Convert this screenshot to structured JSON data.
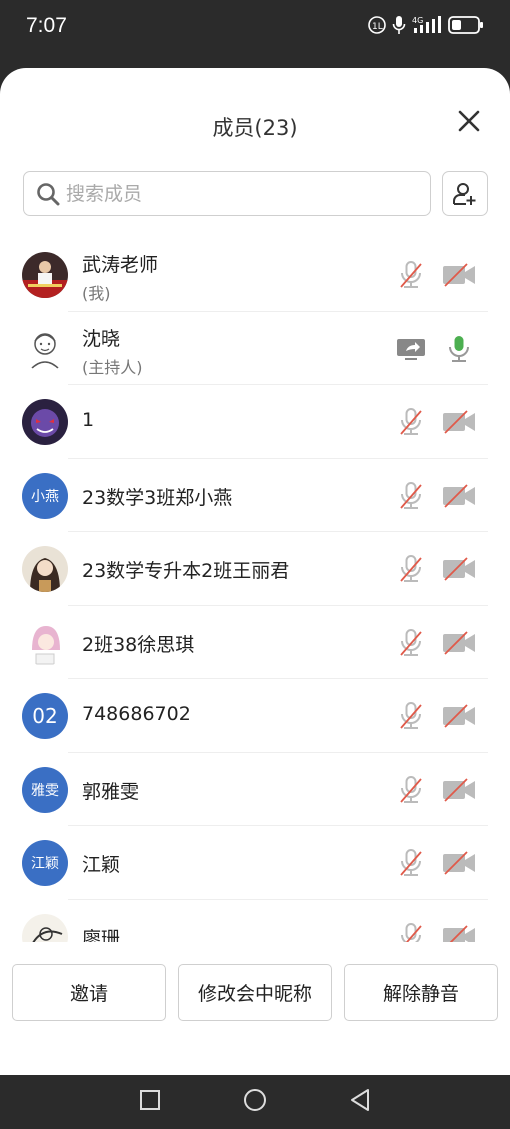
{
  "status": {
    "time": "7:07",
    "network": "4G"
  },
  "header": {
    "title": "成员(23)"
  },
  "search": {
    "placeholder": "搜索成员"
  },
  "members": [
    {
      "name": "武涛老师",
      "role": "(我)",
      "avatar": "photo",
      "mic": "muted",
      "cam": "off"
    },
    {
      "name": "沈晓",
      "role": "(主持人)",
      "avatar": "sketch",
      "mic": "on",
      "cam": "screen-share"
    },
    {
      "name": "1",
      "role": "",
      "avatar": "game",
      "mic": "muted",
      "cam": "off"
    },
    {
      "name": "23数学3班郑小燕",
      "role": "",
      "avatar_text": "小燕",
      "mic": "muted",
      "cam": "off"
    },
    {
      "name": "23数学专升本2班王丽君",
      "role": "",
      "avatar": "girl",
      "mic": "muted",
      "cam": "off"
    },
    {
      "name": "2班38徐思琪",
      "role": "",
      "avatar": "anime",
      "mic": "muted",
      "cam": "off"
    },
    {
      "name": "748686702",
      "role": "",
      "avatar_text": "02",
      "mic": "muted",
      "cam": "off"
    },
    {
      "name": "郭雅雯",
      "role": "",
      "avatar_text": "雅雯",
      "mic": "muted",
      "cam": "off"
    },
    {
      "name": "江颖",
      "role": "",
      "avatar_text": "江颖",
      "mic": "muted",
      "cam": "off"
    },
    {
      "name": "廖珊",
      "role": "",
      "avatar": "ink",
      "mic": "muted",
      "cam": "off"
    }
  ],
  "footer": {
    "invite": "邀请",
    "rename": "修改会中昵称",
    "unmute": "解除静音"
  },
  "colors": {
    "accent": "#3a6fc4",
    "muted_red": "#e05a4a",
    "mic_on_green": "#4caf50"
  }
}
